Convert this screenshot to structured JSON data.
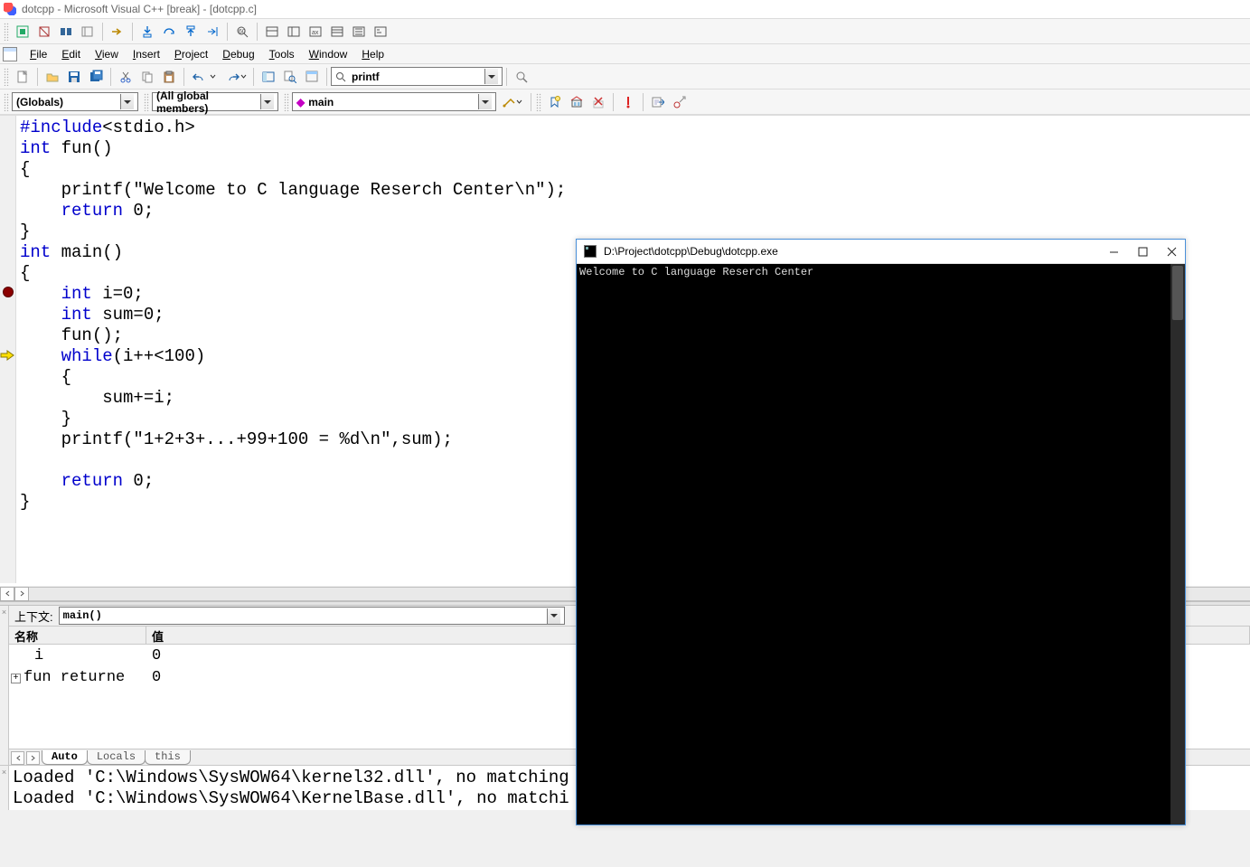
{
  "title": "dotcpp - Microsoft Visual C++ [break] - [dotcpp.c]",
  "menus": {
    "file": "File",
    "edit": "Edit",
    "view": "View",
    "insert": "Insert",
    "project": "Project",
    "debug": "Debug",
    "tools": "Tools",
    "window": "Window",
    "help": "Help"
  },
  "find_box": "printf",
  "scope_combo": "(Globals)",
  "members_combo": "(All global members)",
  "function_combo": "main",
  "context_label": "上下文:",
  "context_value": "main()",
  "var_headers": {
    "name": "名称",
    "value": "值"
  },
  "var_rows": [
    {
      "name": "i",
      "value": "0",
      "expandable": false
    },
    {
      "name": "fun returne",
      "value": "0",
      "expandable": true
    }
  ],
  "var_tabs": {
    "auto": "Auto",
    "locals": "Locals",
    "this": "this"
  },
  "output_lines": [
    "Loaded 'C:\\Windows\\SysWOW64\\kernel32.dll', no matching",
    "Loaded 'C:\\Windows\\SysWOW64\\KernelBase.dll', no matchi"
  ],
  "console": {
    "title": "D:\\Project\\dotcpp\\Debug\\dotcpp.exe",
    "text": "Welcome to C language Reserch Center"
  },
  "code": {
    "l1a": "#include",
    "l1b": "<stdio.h>",
    "l2a": "int",
    "l2b": " fun()",
    "l3": "{",
    "l4": "    printf(\"Welcome to C language Reserch Center\\n\");",
    "l5a": "    ",
    "l5b": "return",
    "l5c": " 0;",
    "l6": "}",
    "l7a": "int",
    "l7b": " main()",
    "l8": "{",
    "l9a": "    ",
    "l9b": "int",
    "l9c": " i=0;",
    "l10a": "    ",
    "l10b": "int",
    "l10c": " sum=0;",
    "l11": "    fun();",
    "l12a": "    ",
    "l12b": "while",
    "l12c": "(i++<100)",
    "l13": "    {",
    "l14": "        sum+=i;",
    "l15": "    }",
    "l16": "    printf(\"1+2+3+...+99+100 = %d\\n\",sum);",
    "l17": "",
    "l18a": "    ",
    "l18b": "return",
    "l18c": " 0;",
    "l19": "}"
  }
}
